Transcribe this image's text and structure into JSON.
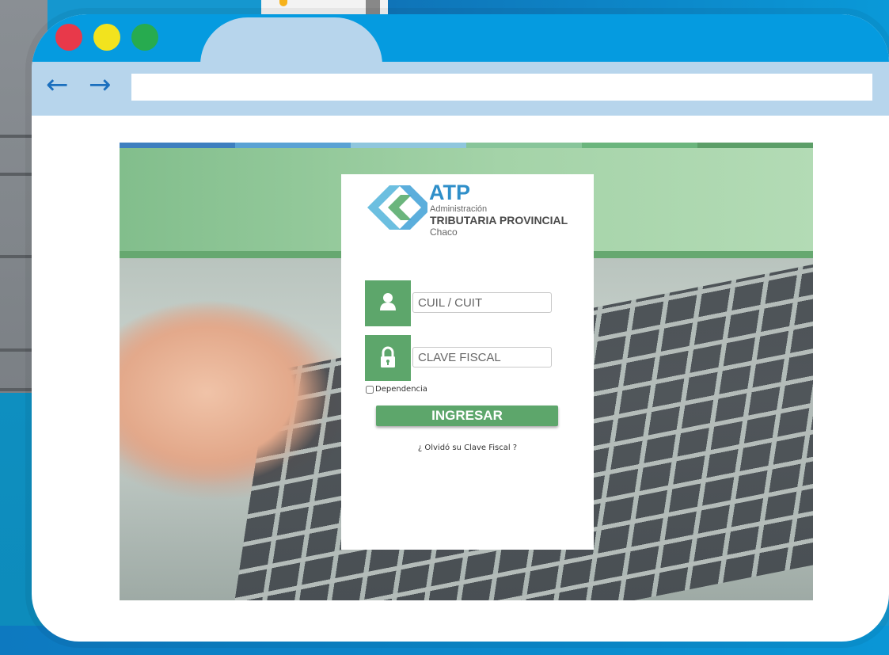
{
  "colors": {
    "browser_blue": "#059be0",
    "tab_light": "#b7d5ec",
    "accent_green": "#5da66b",
    "logo_blue": "#2f8fc9"
  },
  "browser": {
    "nav_back_icon": "arrow-left-icon",
    "nav_forward_icon": "arrow-right-icon",
    "address_value": ""
  },
  "logo": {
    "brand": "ATP",
    "line1": "Administración",
    "line2": "TRIBUTARIA PROVINCIAL",
    "line3": "Chaco"
  },
  "login": {
    "cuil_placeholder": "CUIL / CUIT",
    "clave_placeholder": "CLAVE FISCAL",
    "dependencia_label": "Dependencia",
    "dependencia_checked": false,
    "submit_label": "INGRESAR",
    "forgot_link": "¿ Olvidó su Clave Fiscal ?"
  }
}
